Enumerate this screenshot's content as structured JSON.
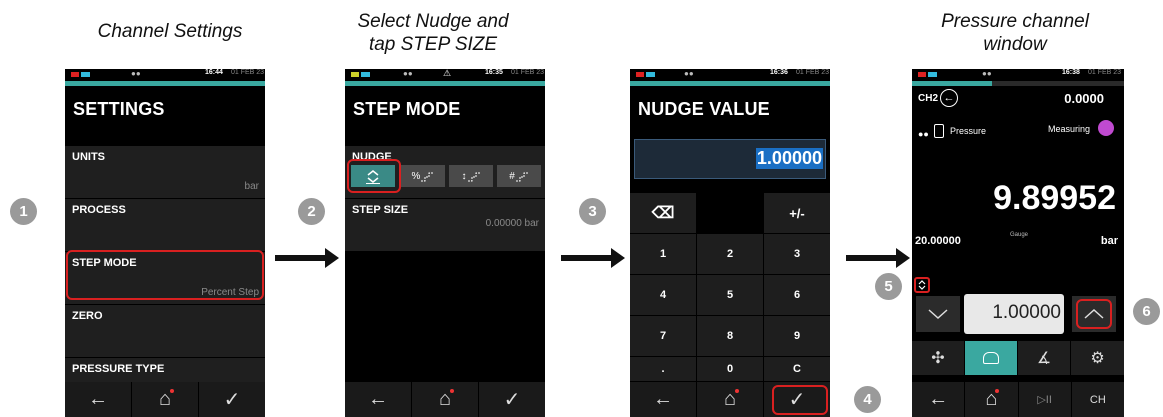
{
  "captions": {
    "c1": "Channel Settings",
    "c2": "Select Nudge and tap STEP SIZE",
    "c3": "Pressure channel window"
  },
  "step_numbers": [
    "1",
    "2",
    "3",
    "4",
    "5",
    "6"
  ],
  "screen1": {
    "status": {
      "glyph": "●●",
      "time": "16:44",
      "date": "01 FEB 23"
    },
    "title": "SETTINGS",
    "rows": [
      {
        "label": "UNITS",
        "value": "bar"
      },
      {
        "label": "PROCESS",
        "value": ""
      },
      {
        "label": "STEP MODE",
        "value": "Percent Step"
      },
      {
        "label": "ZERO",
        "value": ""
      },
      {
        "label": "PRESSURE TYPE",
        "value": ""
      }
    ]
  },
  "screen2": {
    "status": {
      "glyph": "●●",
      "warn": "⚠",
      "time": "16:35",
      "date": "01 FEB 23"
    },
    "title": "STEP MODE",
    "nudge_label": "NUDGE",
    "mode_icons": [
      "%",
      "↕",
      "#"
    ],
    "step_size_label": "STEP SIZE",
    "step_size_value": "0.00000 bar"
  },
  "screen3": {
    "status": {
      "glyph": "●●",
      "time": "16:36",
      "date": "01 FEB 23"
    },
    "title": "NUDGE VALUE",
    "input_value": "1.00000",
    "keys": [
      "⌫",
      "",
      "+/-",
      "1",
      "2",
      "3",
      "4",
      "5",
      "6",
      "7",
      "8",
      "9",
      ".",
      "0",
      "C"
    ]
  },
  "screen4": {
    "status": {
      "glyph": "●●",
      "time": "16:38",
      "date": "01 FEB 23"
    },
    "channel": "CH2",
    "header_value": "0.0000",
    "sensor_label": "Pressure",
    "state_label": "Measuring",
    "main_value": "9.89952",
    "range_value": "20.00000",
    "gauge_label": "Gauge",
    "unit": "bar",
    "nudge_value": "1.00000"
  },
  "nav": {
    "back": "←",
    "home": "⌂",
    "ok": "✓",
    "play": "▷II",
    "ch": "CH"
  },
  "colors": {
    "accent": "#3aa8a0",
    "highlight": "#d92020",
    "badge": "#9a9a9a"
  }
}
